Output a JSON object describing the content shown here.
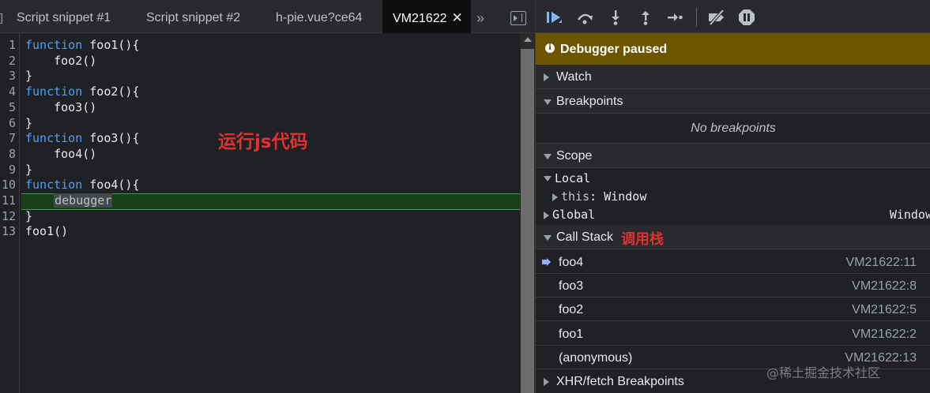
{
  "editor": {
    "tabs": [
      {
        "label": "Script snippet #1",
        "active": false
      },
      {
        "label": "Script snippet #2",
        "active": false
      },
      {
        "label": "h-pie.vue?ce64",
        "active": false
      },
      {
        "label": "VM21622",
        "active": true
      }
    ],
    "tab_edge_glyph": "]",
    "close_glyph": "✕",
    "more_tabs_glyph": "»",
    "lines": [
      {
        "no": "1",
        "kw": "function",
        "rest": " foo1(){"
      },
      {
        "no": "2",
        "kw": "",
        "rest": "    foo2()"
      },
      {
        "no": "3",
        "kw": "",
        "rest": "}"
      },
      {
        "no": "4",
        "kw": "function",
        "rest": " foo2(){"
      },
      {
        "no": "5",
        "kw": "",
        "rest": "    foo3()"
      },
      {
        "no": "6",
        "kw": "",
        "rest": "}"
      },
      {
        "no": "7",
        "kw": "function",
        "rest": " foo3(){"
      },
      {
        "no": "8",
        "kw": "",
        "rest": "    foo4()"
      },
      {
        "no": "9",
        "kw": "",
        "rest": "}"
      },
      {
        "no": "10",
        "kw": "function",
        "rest": " foo4(){"
      },
      {
        "no": "11",
        "kw": "",
        "rest": "    ",
        "debugger": "debugger"
      },
      {
        "no": "12",
        "kw": "",
        "rest": "}"
      },
      {
        "no": "13",
        "kw": "",
        "rest": "foo1()"
      }
    ],
    "paused_line": "11",
    "annotation": "运行js代码"
  },
  "debugger": {
    "paused_text": "Debugger paused",
    "info_glyph": "i",
    "sections": {
      "watch": "Watch",
      "breakpoints": "Breakpoints",
      "no_breakpoints": "No breakpoints",
      "scope": "Scope",
      "call_stack": "Call Stack",
      "xhr": "XHR/fetch Breakpoints"
    },
    "scope": {
      "local_label": "Local",
      "this_key": "this",
      "this_sep": ": ",
      "this_value": "Window",
      "global_label": "Global",
      "global_value": "Window"
    },
    "call_stack_annotation": "调用栈",
    "frames": [
      {
        "fn": "foo4",
        "loc": "VM21622:11",
        "current": true
      },
      {
        "fn": "foo3",
        "loc": "VM21622:8",
        "current": false
      },
      {
        "fn": "foo2",
        "loc": "VM21622:5",
        "current": false
      },
      {
        "fn": "foo1",
        "loc": "VM21622:2",
        "current": false
      },
      {
        "fn": "(anonymous)",
        "loc": "VM21622:13",
        "current": false
      }
    ],
    "toolbar_icons": [
      "resume-icon",
      "step-over-icon",
      "step-into-icon",
      "step-out-icon",
      "step-icon",
      "deactivate-breakpoints-icon",
      "pause-on-exceptions-icon"
    ],
    "accent_color": "#8ab4f8",
    "paused_bar_color": "#6d5400"
  },
  "watermark": "@稀土掘金技术社区"
}
